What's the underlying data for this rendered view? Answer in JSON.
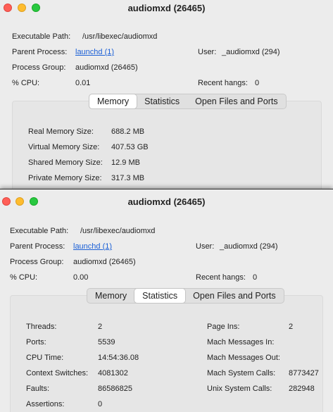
{
  "window1": {
    "title": "audiomxd (26465)",
    "executable_path_label": "Executable Path:",
    "executable_path_value": "/usr/libexec/audiomxd",
    "parent_process_label": "Parent Process:",
    "parent_process_value": "launchd (1)",
    "user_label": "User:",
    "user_value": "_audiomxd (294)",
    "process_group_label": "Process Group:",
    "process_group_value": "audiomxd (26465)",
    "cpu_label": "% CPU:",
    "cpu_value": "0.01",
    "recent_hangs_label": "Recent hangs:",
    "recent_hangs_value": "0",
    "tabs": [
      "Memory",
      "Statistics",
      "Open Files and Ports"
    ],
    "active_tab": "Memory",
    "memory": [
      {
        "label": "Real Memory Size:",
        "value": "688.2 MB"
      },
      {
        "label": "Virtual Memory Size:",
        "value": "407.53 GB"
      },
      {
        "label": "Shared Memory Size:",
        "value": "12.9 MB"
      },
      {
        "label": "Private Memory Size:",
        "value": "317.3 MB"
      }
    ]
  },
  "window2": {
    "title": "audiomxd (26465)",
    "executable_path_label": "Executable Path:",
    "executable_path_value": "/usr/libexec/audiomxd",
    "parent_process_label": "Parent Process:",
    "parent_process_value": "launchd (1)",
    "user_label": "User:",
    "user_value": "_audiomxd (294)",
    "process_group_label": "Process Group:",
    "process_group_value": "audiomxd (26465)",
    "cpu_label": "% CPU:",
    "cpu_value": "0.00",
    "recent_hangs_label": "Recent hangs:",
    "recent_hangs_value": "0",
    "tabs": [
      "Memory",
      "Statistics",
      "Open Files and Ports"
    ],
    "active_tab": "Statistics",
    "stats_left": [
      {
        "label": "Threads:",
        "value": "2"
      },
      {
        "label": "Ports:",
        "value": "5539"
      },
      {
        "label": "CPU Time:",
        "value": "14:54:36.08"
      },
      {
        "label": "Context Switches:",
        "value": "4081302"
      },
      {
        "label": "Faults:",
        "value": "86586825"
      },
      {
        "label": "Assertions:",
        "value": "0"
      }
    ],
    "stats_right": [
      {
        "label": "Page Ins:",
        "value": "2"
      },
      {
        "label": "Mach Messages In:",
        "value": ""
      },
      {
        "label": "Mach Messages Out:",
        "value": ""
      },
      {
        "label": "Mach System Calls:",
        "value": "8773427"
      },
      {
        "label": "Unix System Calls:",
        "value": "282948"
      }
    ]
  }
}
